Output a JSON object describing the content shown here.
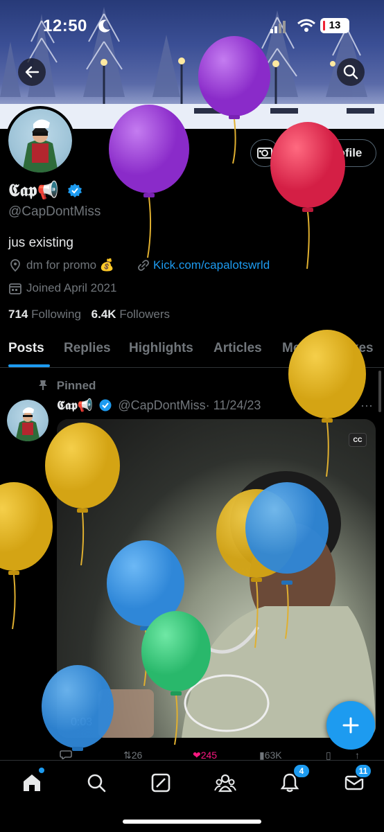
{
  "status_bar": {
    "time": "12:50",
    "battery": "13"
  },
  "profile": {
    "edit_profile_label": "Edit profile",
    "display_name": "𝕮𝖆𝖕📢",
    "handle": "@CapDontMiss",
    "bio": "jus existing",
    "location": "dm for promo 💰",
    "website": "Kick.com/capalotswrld",
    "joined": "Joined April 2021",
    "following_count": "714",
    "following_label": "Following",
    "followers_count": "6.4K",
    "followers_label": "Followers"
  },
  "tabs": [
    "Posts",
    "Replies",
    "Highlights",
    "Articles",
    "Media",
    "Likes"
  ],
  "post": {
    "pinned_label": "Pinned",
    "author_name": "𝕮𝖆𝖕📢",
    "author_handle": "@CapDontMiss",
    "date": "· 11/24/23",
    "more": "···",
    "cc_label": "CC",
    "video_time": "0:03",
    "actions": {
      "retweets": "26",
      "likes": "245",
      "views": "63K"
    }
  },
  "nav": {
    "notifications_badge": "4",
    "messages_badge": "11"
  },
  "colors": {
    "accent": "#1d9bf0",
    "like": "#f91880",
    "background": "#000000"
  },
  "icons": [
    "back-arrow-icon",
    "search-icon",
    "camera-icon",
    "verified-icon",
    "location-icon",
    "link-icon",
    "calendar-icon",
    "pin-icon",
    "plus-icon",
    "home-icon",
    "grok-icon",
    "communities-icon",
    "bell-icon",
    "mail-icon"
  ]
}
